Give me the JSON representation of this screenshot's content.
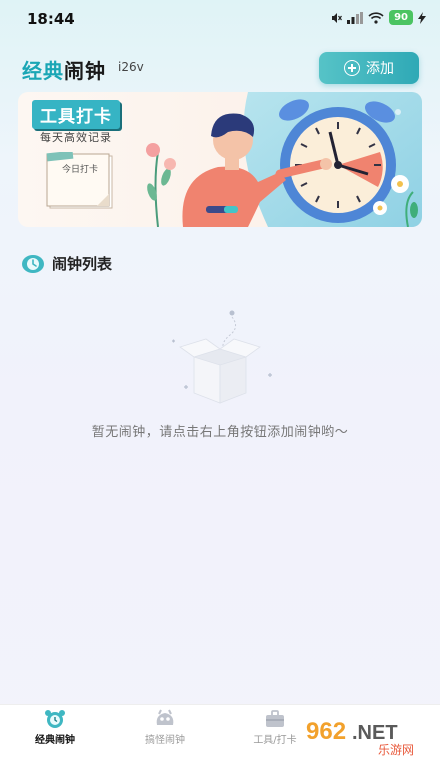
{
  "status": {
    "time": "18:44",
    "battery": "90"
  },
  "header": {
    "title_part1": "经典",
    "title_part2": "闹钟",
    "version": "i26v",
    "add_label": "添加"
  },
  "banner": {
    "title": "工具打卡",
    "subtitle": "每天高效记录",
    "note_text": "今日打卡"
  },
  "section": {
    "title": "闹钟列表"
  },
  "empty": {
    "message": "暂无闹钟，请点击右上角按钮添加闹钟哟～"
  },
  "tabs": [
    {
      "label": "经典闹钟",
      "icon": "alarm-clock-icon",
      "active": true
    },
    {
      "label": "搞怪闹钟",
      "icon": "monster-icon",
      "active": false
    },
    {
      "label": "工具/打卡",
      "icon": "toolbox-icon",
      "active": false
    }
  ],
  "watermark": {
    "text": "962.NET",
    "subtext": "乐游网"
  },
  "colors": {
    "accent": "#2fa9b6",
    "banner_right": "#9fd9ea",
    "clock_blue": "#4e86d6",
    "person_shirt": "#f0836f"
  }
}
